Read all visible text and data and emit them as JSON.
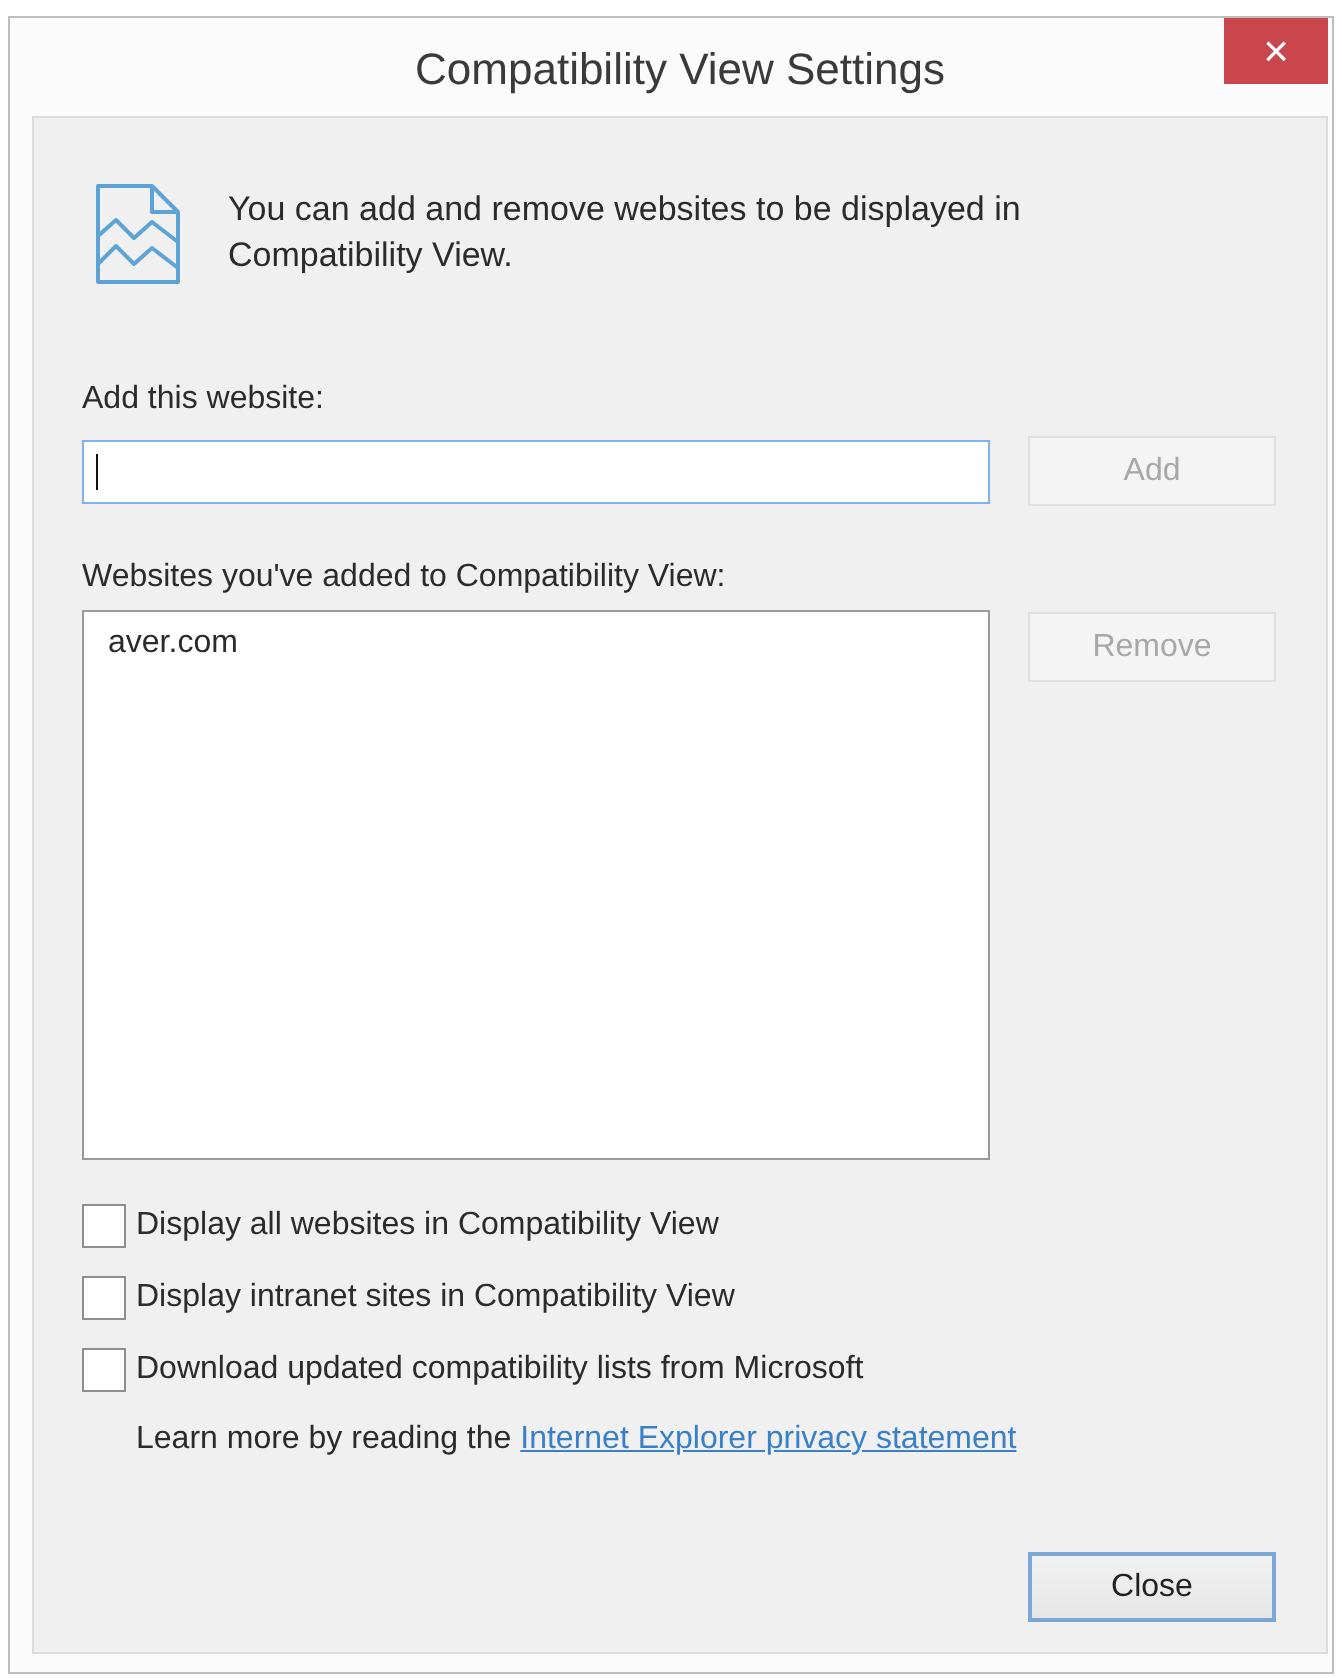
{
  "window": {
    "title": "Compatibility View Settings",
    "close_glyph": "×"
  },
  "intro": {
    "text": "You can add and remove websites to be displayed in Compatibility View."
  },
  "add_website": {
    "label": "Add this website:",
    "field": {
      "focused": true
    },
    "button": {
      "label": "Add",
      "disabled": true
    }
  },
  "websites": {
    "label": "Websites you've added to Compatibility View:",
    "items": [
      {
        "text": "aver.com",
        "selected": false
      }
    ],
    "button": {
      "label": "Remove",
      "disabled": true
    }
  },
  "options": [
    {
      "label": "Display all websites in Compatibility View",
      "checked": false
    },
    {
      "label": "Display intranet sites in Compatibility View",
      "checked": false
    },
    {
      "label": "Download updated compatibility lists from Microsoft",
      "checked": false
    }
  ],
  "privacy": {
    "text": "Learn more by reading the",
    "link": "Internet Explorer privacy statement"
  },
  "buttons": [
    {
      "label": "Close",
      "disabled": false,
      "default": true
    }
  ]
}
